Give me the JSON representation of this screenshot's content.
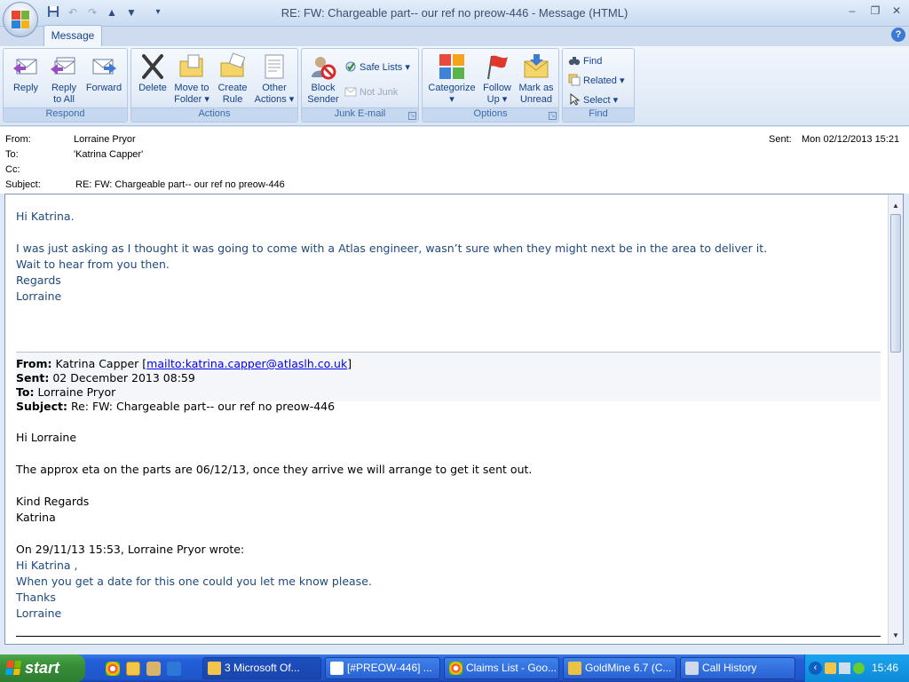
{
  "window": {
    "title": "RE: FW: Chargeable part-- our ref no preow-446 - Message (HTML)",
    "minimize": "–",
    "restore": "❐",
    "close": "✕"
  },
  "tabs": {
    "message": "Message",
    "help": "?"
  },
  "ribbon": {
    "respond": {
      "label": "Respond",
      "reply": "Reply",
      "reply_all_1": "Reply",
      "reply_all_2": "to All",
      "forward": "Forward"
    },
    "actions": {
      "label": "Actions",
      "delete": "Delete",
      "move_1": "Move to",
      "move_2": "Folder ▾",
      "rule_1": "Create",
      "rule_2": "Rule",
      "other_1": "Other",
      "other_2": "Actions ▾"
    },
    "junk": {
      "label": "Junk E-mail",
      "block_1": "Block",
      "block_2": "Sender",
      "safe_lists": "Safe Lists ▾",
      "not_junk": "Not Junk"
    },
    "options": {
      "label": "Options",
      "categorize": "Categorize",
      "categorize_2": "▾",
      "follow_1": "Follow",
      "follow_2": "Up ▾",
      "mark_1": "Mark as",
      "mark_2": "Unread"
    },
    "find": {
      "label": "Find",
      "find": "Find",
      "related": "Related ▾",
      "select": "Select ▾"
    }
  },
  "header": {
    "from_label": "From:",
    "from": "Lorraine Pryor",
    "to_label": "To:",
    "to": "'Katrina Capper'",
    "cc_label": "Cc:",
    "cc": "",
    "subject_label": "Subject:",
    "subject": "RE: FW: Chargeable part-- our ref no preow-446",
    "sent_label": "Sent:",
    "sent": "Mon 02/12/2013 15:21"
  },
  "body": {
    "reply": [
      "Hi Katrina.",
      "I was just asking as I thought it was going to come with a Atlas engineer,  wasn’t sure when they might next be in the area to deliver it.",
      "Wait to hear from you then.",
      "Regards",
      "Lorraine"
    ],
    "quoted_header": {
      "from_label": "From:",
      "from_name": "Katrina Capper [",
      "from_link": "mailto:katrina.capper@atlaslh.co.uk",
      "from_end": "]",
      "sent_label": "Sent:",
      "sent": "02 December 2013 08:59",
      "to_label": "To:",
      "to": "Lorraine Pryor",
      "subject_label": "Subject:",
      "subject": "Re: FW: Chargeable part-- our ref no preow-446"
    },
    "quoted": [
      "Hi Lorraine",
      "The approx eta on the parts are 06/12/13, once they arrive we will arrange to get it sent out.",
      "Kind Regards",
      "Katrina",
      "On 29/11/13 15:53, Lorraine Pryor wrote:"
    ],
    "nested": [
      "Hi Katrina ,",
      "When you get a date for this one could you let me know please.",
      "Thanks",
      "Lorraine"
    ]
  },
  "taskbar": {
    "start": "start",
    "tasks": [
      "3 Microsoft Of...",
      "[#PREOW-446] ...",
      "Claims List - Goo...",
      "GoldMine 6.7 (C...",
      "Call History"
    ],
    "clock": "15:46"
  }
}
